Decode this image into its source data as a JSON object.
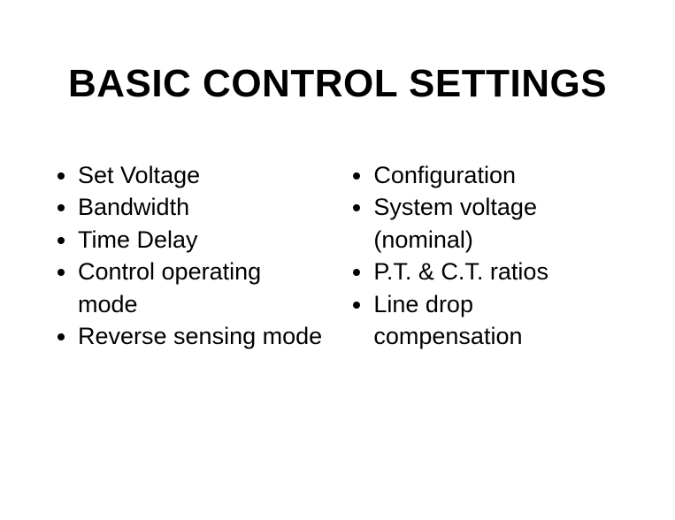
{
  "title": "BASIC CONTROL SETTINGS",
  "left": {
    "items": [
      "Set Voltage",
      "Bandwidth",
      "Time Delay",
      "Control operating mode",
      "Reverse sensing mode"
    ]
  },
  "right": {
    "items": [
      "Configuration",
      "System voltage (nominal)",
      "P.T. & C.T. ratios",
      "Line drop compensation"
    ]
  }
}
